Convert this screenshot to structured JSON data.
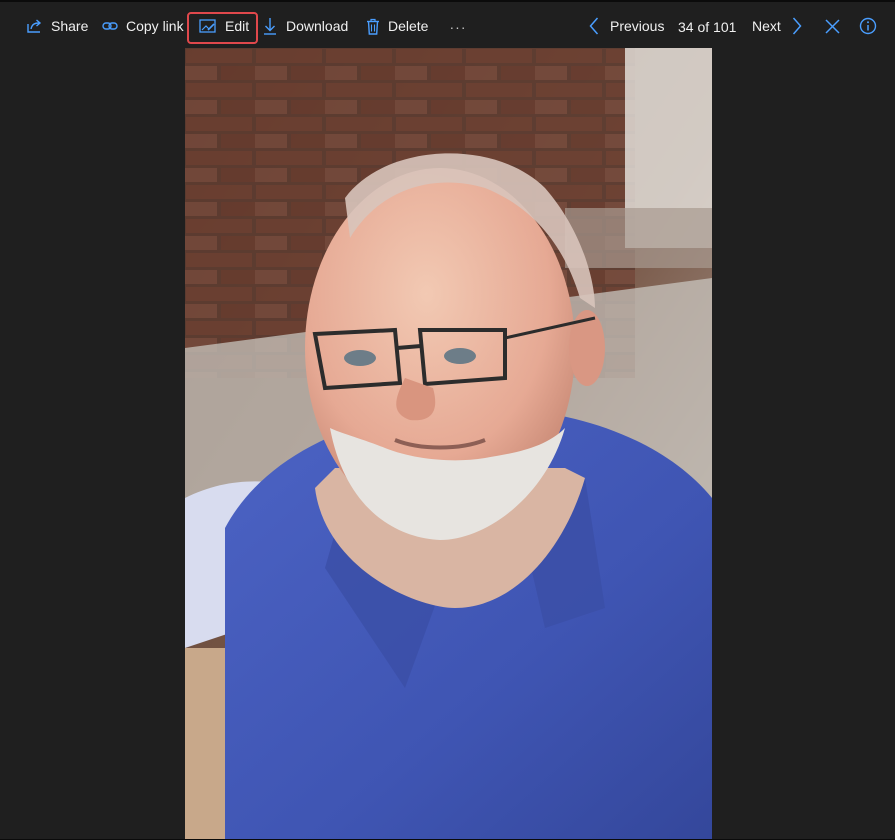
{
  "toolbar": {
    "share_label": "Share",
    "copy_link_label": "Copy link",
    "edit_label": "Edit",
    "download_label": "Download",
    "delete_label": "Delete",
    "more_label": "···",
    "previous_label": "Previous",
    "counter_text": "34 of 101",
    "next_label": "Next"
  },
  "icons": {
    "share": "share-icon",
    "copy_link": "link-icon",
    "edit": "edit-image-icon",
    "download": "download-icon",
    "delete": "trash-icon",
    "previous": "chevron-left-icon",
    "next": "chevron-right-icon",
    "close": "close-icon",
    "info": "info-icon"
  },
  "colors": {
    "accent": "#4a9eff",
    "toolbar_bg": "#1f1f1f",
    "highlight": "#e0484c",
    "text": "#f0f0f0"
  }
}
